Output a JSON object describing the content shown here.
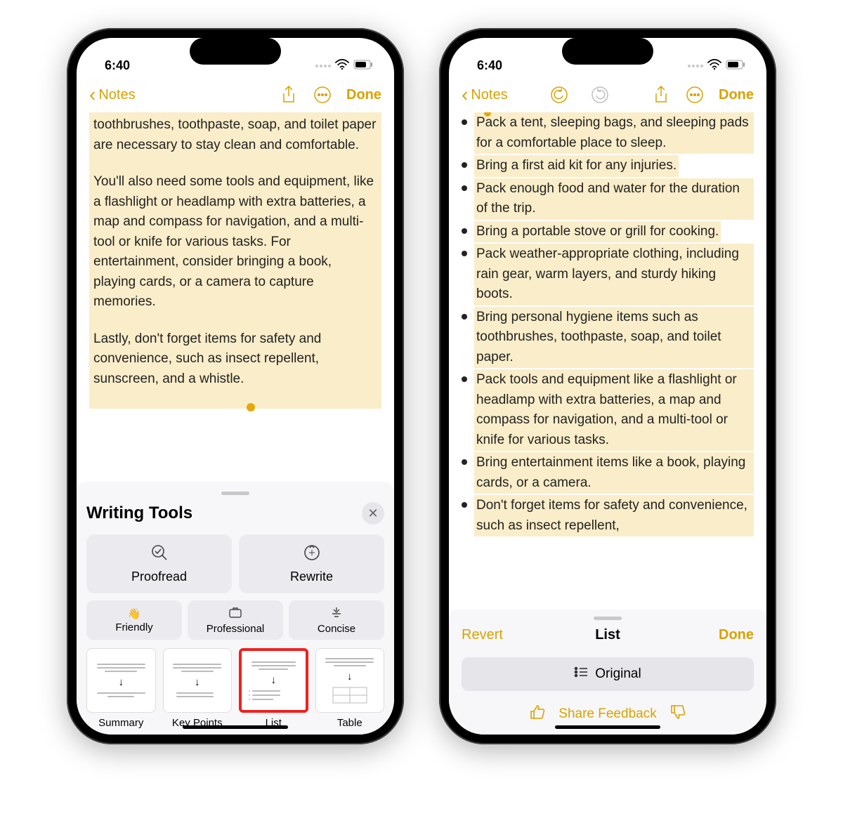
{
  "status": {
    "time": "6:40"
  },
  "nav": {
    "back_label": "Notes",
    "done_label": "Done"
  },
  "left": {
    "para1": "toothbrushes, toothpaste, soap, and toilet paper are necessary to stay clean and comfortable.",
    "para2": "You'll also need some tools and equipment, like a flashlight or headlamp with extra batteries, a map and compass for navigation, and a multi-tool or knife for various tasks. For entertainment, consider bringing a book, playing cards, or a camera to capture memories.",
    "para3": "Lastly, don't forget items for safety and convenience, such as insect repellent, sunscreen, and a whistle."
  },
  "panel": {
    "title": "Writing Tools",
    "proofread": "Proofread",
    "rewrite": "Rewrite",
    "friendly": "Friendly",
    "professional": "Professional",
    "concise": "Concise",
    "summary": "Summary",
    "keypoints": "Key Points",
    "list": "List",
    "table": "Table"
  },
  "right": {
    "bullets": [
      "Pack a tent, sleeping bags, and sleeping pads for a comfortable place to sleep.",
      "Bring a first aid kit for any injuries.",
      "Pack enough food and water for the duration of the trip.",
      "Bring a portable stove or grill for cooking.",
      "Pack weather-appropriate clothing, including rain gear, warm layers, and sturdy hiking boots.",
      "Bring personal hygiene items such as toothbrushes, toothpaste, soap, and toilet paper.",
      "Pack tools and equipment like a flashlight or headlamp with extra batteries, a map and compass for navigation, and a multi-tool or knife for various tasks.",
      "Bring entertainment items like a book, playing cards, or a camera.",
      "Don't forget items for safety and convenience, such as insect repellent,"
    ],
    "revert": "Revert",
    "list_title": "List",
    "done": "Done",
    "original": "Original",
    "feedback": "Share Feedback"
  }
}
